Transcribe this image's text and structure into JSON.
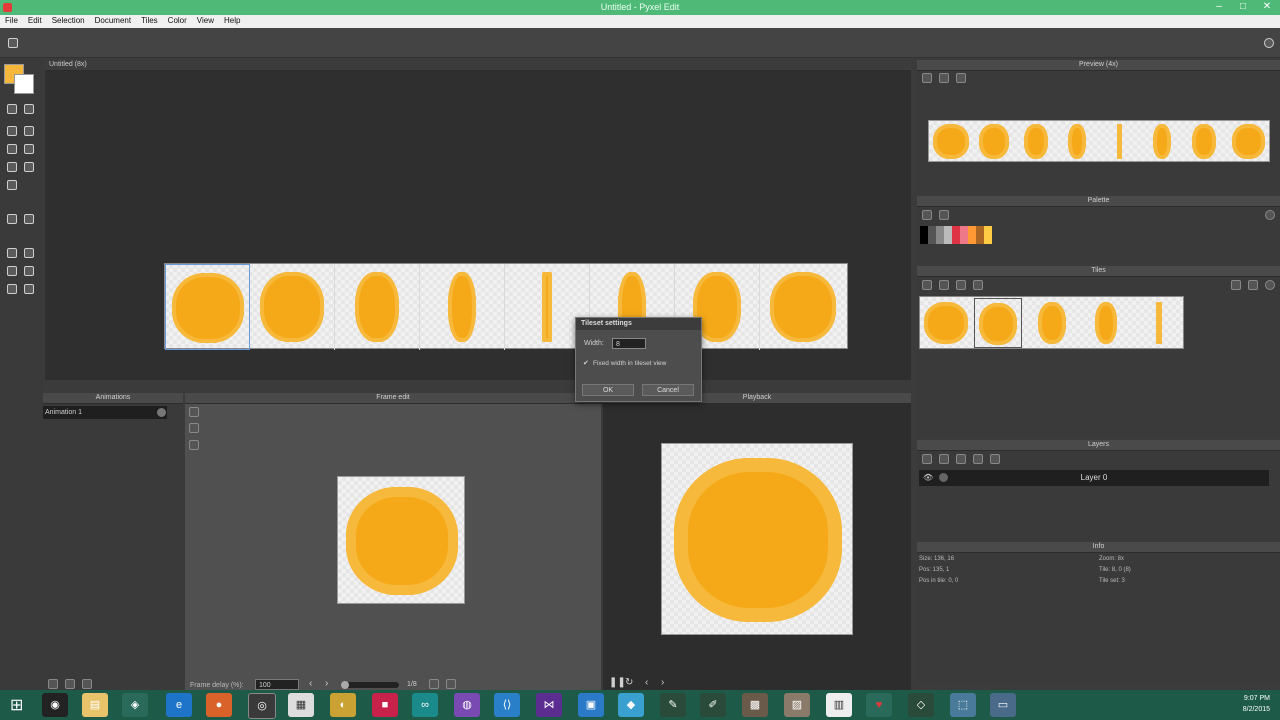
{
  "window": {
    "title": "Untitled - Pyxel Edit"
  },
  "menu": [
    "File",
    "Edit",
    "Selection",
    "Document",
    "Tiles",
    "Color",
    "View",
    "Help"
  ],
  "document": {
    "tab_title": "Untitled (8x)"
  },
  "panels": {
    "preview": "Preview (4x)",
    "palette": "Palette",
    "tiles": "Tiles",
    "layers": "Layers",
    "info": "Info",
    "animations": "Animations",
    "frame_edit": "Frame edit",
    "playback": "Playback"
  },
  "layers": [
    {
      "name": "Layer 0"
    }
  ],
  "animations": [
    {
      "name": "Animation 1"
    }
  ],
  "frame_controls": {
    "delay_label": "Frame delay (%):",
    "delay_value": "100",
    "frame_counter": "1/8"
  },
  "dialog": {
    "title": "Tileset settings",
    "width_label": "Width:",
    "width_value": "8",
    "checkbox_label": "Fixed width in tileset view",
    "ok": "OK",
    "cancel": "Cancel"
  },
  "info": {
    "size": "Size: 136, 16",
    "pos": "Pos: 135, 1",
    "pos_in_tile": "Pos in tile: 0, 0",
    "zoom": "Zoom: 8x",
    "tile": "Tile: 8, 0 (8)",
    "tile_set": "Tile set: 3"
  },
  "taskbar": {
    "time": "9:07 PM",
    "date": "8/2/2015"
  },
  "colors": {
    "primary": "#f5b73b",
    "secondary": "#ffffff",
    "accent": "#f5a918",
    "titlebar": "#4fb978"
  }
}
